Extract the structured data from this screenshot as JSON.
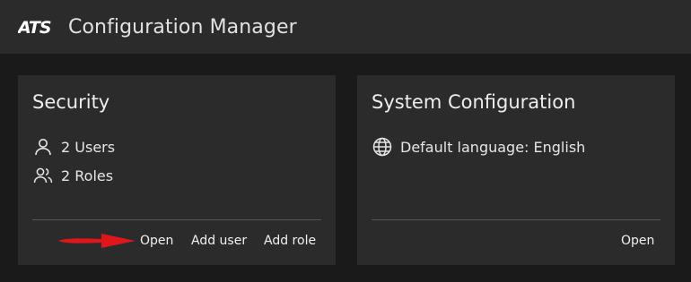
{
  "app": {
    "title": "Configuration Manager",
    "logo_text": "ATS"
  },
  "security": {
    "title": "Security",
    "users": "2 Users",
    "roles": "2 Roles",
    "actions": {
      "open": "Open",
      "add_user": "Add user",
      "add_role": "Add role"
    }
  },
  "system": {
    "title": "System Configuration",
    "language": "Default language: English",
    "actions": {
      "open": "Open"
    }
  },
  "annotation": {
    "arrow_color": "#e0161b"
  },
  "icons": [
    "user-icon",
    "users-icon",
    "globe-icon"
  ]
}
